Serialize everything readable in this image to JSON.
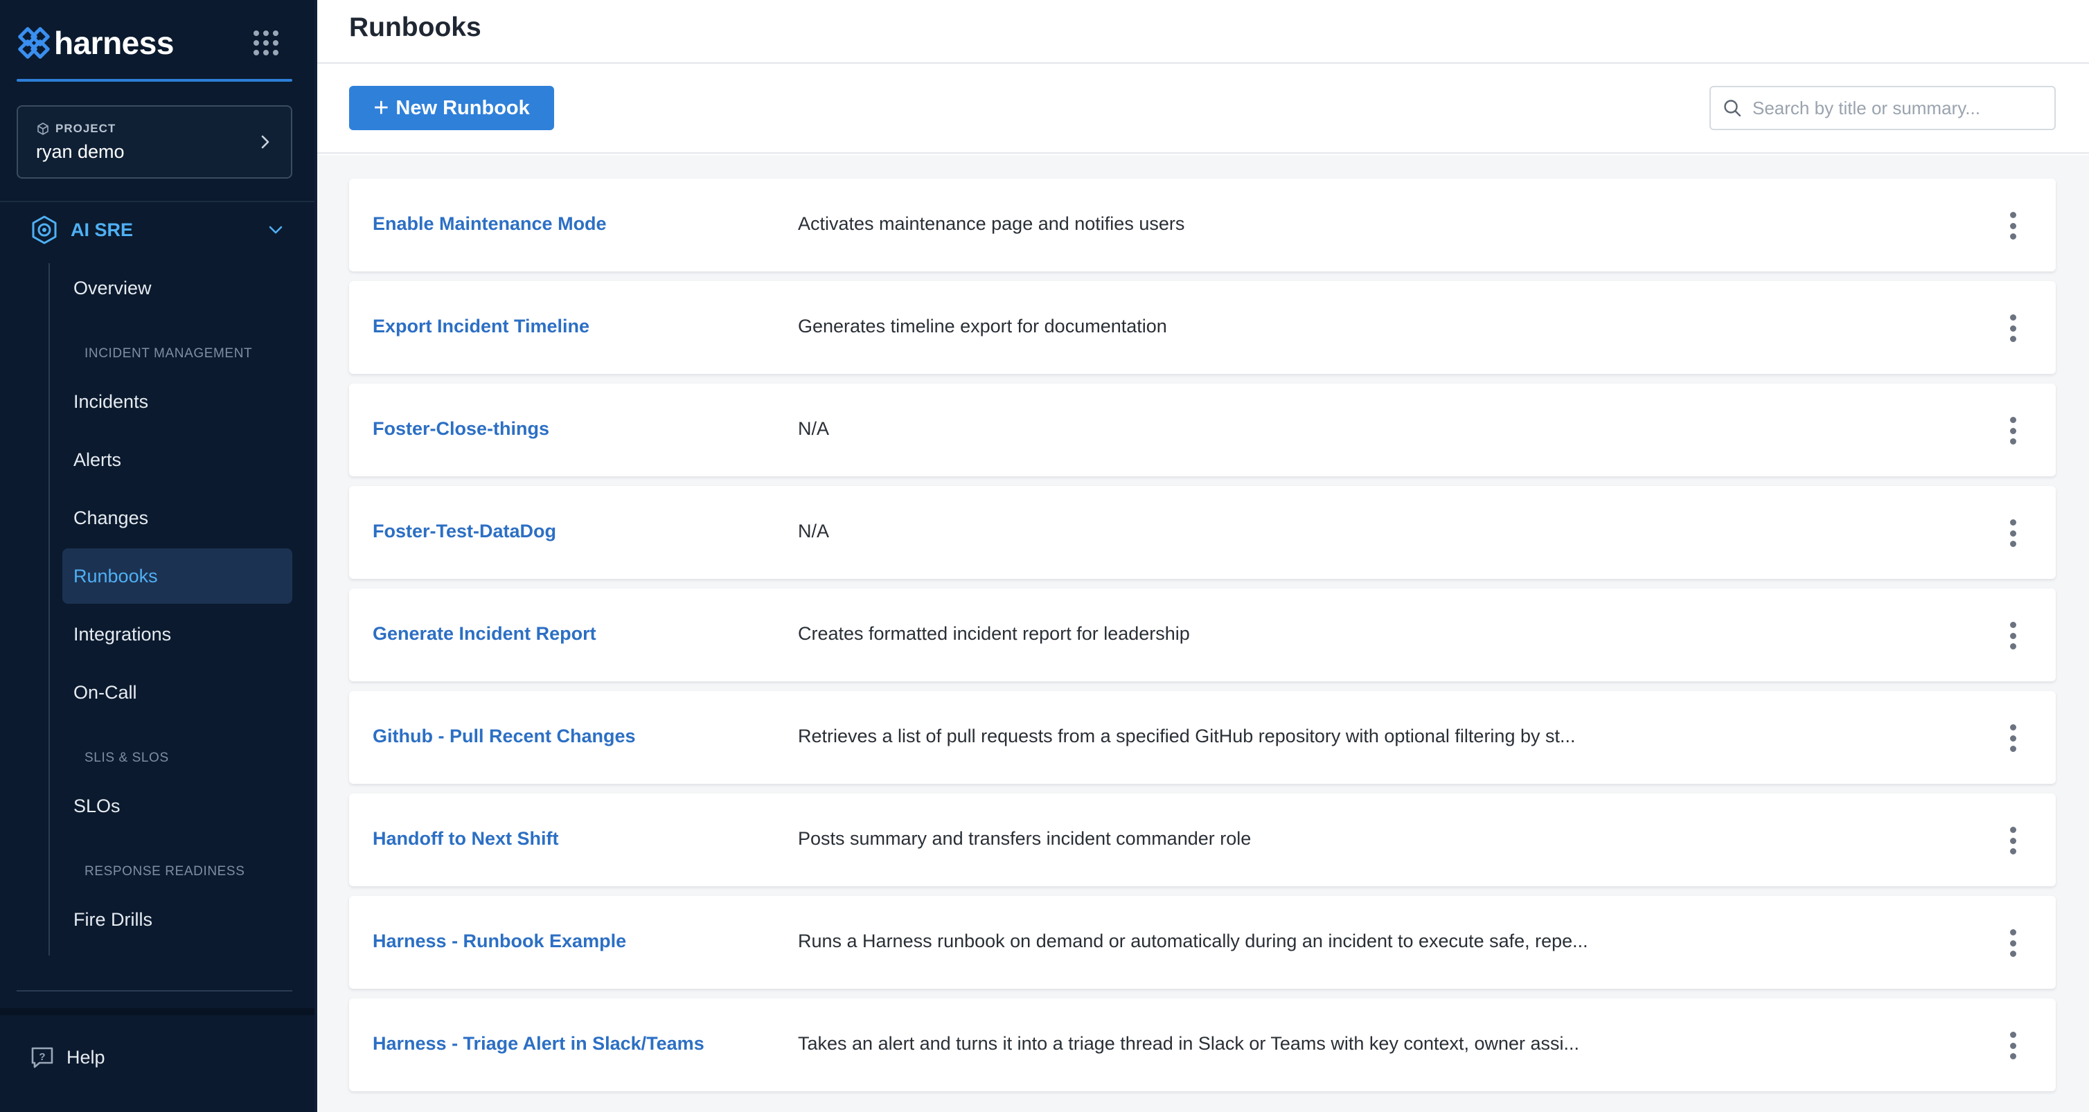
{
  "brand": {
    "name": "harness"
  },
  "project": {
    "label": "PROJECT",
    "name": "ryan demo"
  },
  "module": {
    "label": "AI SRE"
  },
  "nav": {
    "overview": "Overview",
    "section_incident": "INCIDENT MANAGEMENT",
    "incidents": "Incidents",
    "alerts": "Alerts",
    "changes": "Changes",
    "runbooks": "Runbooks",
    "integrations": "Integrations",
    "oncall": "On-Call",
    "section_slis": "SLIS & SLOS",
    "slos": "SLOs",
    "section_readiness": "RESPONSE READINESS",
    "fire_drills": "Fire Drills",
    "help": "Help",
    "active": "runbooks"
  },
  "page": {
    "title": "Runbooks"
  },
  "toolbar": {
    "new_plus": "+",
    "new_label": "New Runbook",
    "search_placeholder": "Search by title or summary..."
  },
  "runbooks": [
    {
      "title": "Enable Maintenance Mode",
      "summary": "Activates maintenance page and notifies users"
    },
    {
      "title": "Export Incident Timeline",
      "summary": "Generates timeline export for documentation"
    },
    {
      "title": "Foster-Close-things",
      "summary": "N/A"
    },
    {
      "title": "Foster-Test-DataDog",
      "summary": "N/A"
    },
    {
      "title": "Generate Incident Report",
      "summary": "Creates formatted incident report for leadership"
    },
    {
      "title": "Github - Pull Recent Changes",
      "summary": "Retrieves a list of pull requests from a specified GitHub repository with optional filtering by st..."
    },
    {
      "title": "Handoff to Next Shift",
      "summary": "Posts summary and transfers incident commander role"
    },
    {
      "title": "Harness - Runbook Example",
      "summary": "Runs a Harness runbook on demand or automatically during an incident to execute safe, repe..."
    },
    {
      "title": "Harness - Triage Alert in Slack/Teams",
      "summary": "Takes an alert and turns it into a triage thread in Slack or Teams with key context, owner assi..."
    }
  ],
  "colors": {
    "sidebar_bg": "#0b1a2e",
    "accent": "#2f80d9",
    "active_nav_text": "#4fb0f4",
    "link": "#2c6fc4"
  },
  "icons": {
    "logo": "harness-logo-icon",
    "apps": "app-grid-icon",
    "project": "cube-icon",
    "module": "ai-sre-icon",
    "search": "search-icon",
    "help": "help-chat-icon",
    "row_menu": "more-vertical-icon"
  }
}
